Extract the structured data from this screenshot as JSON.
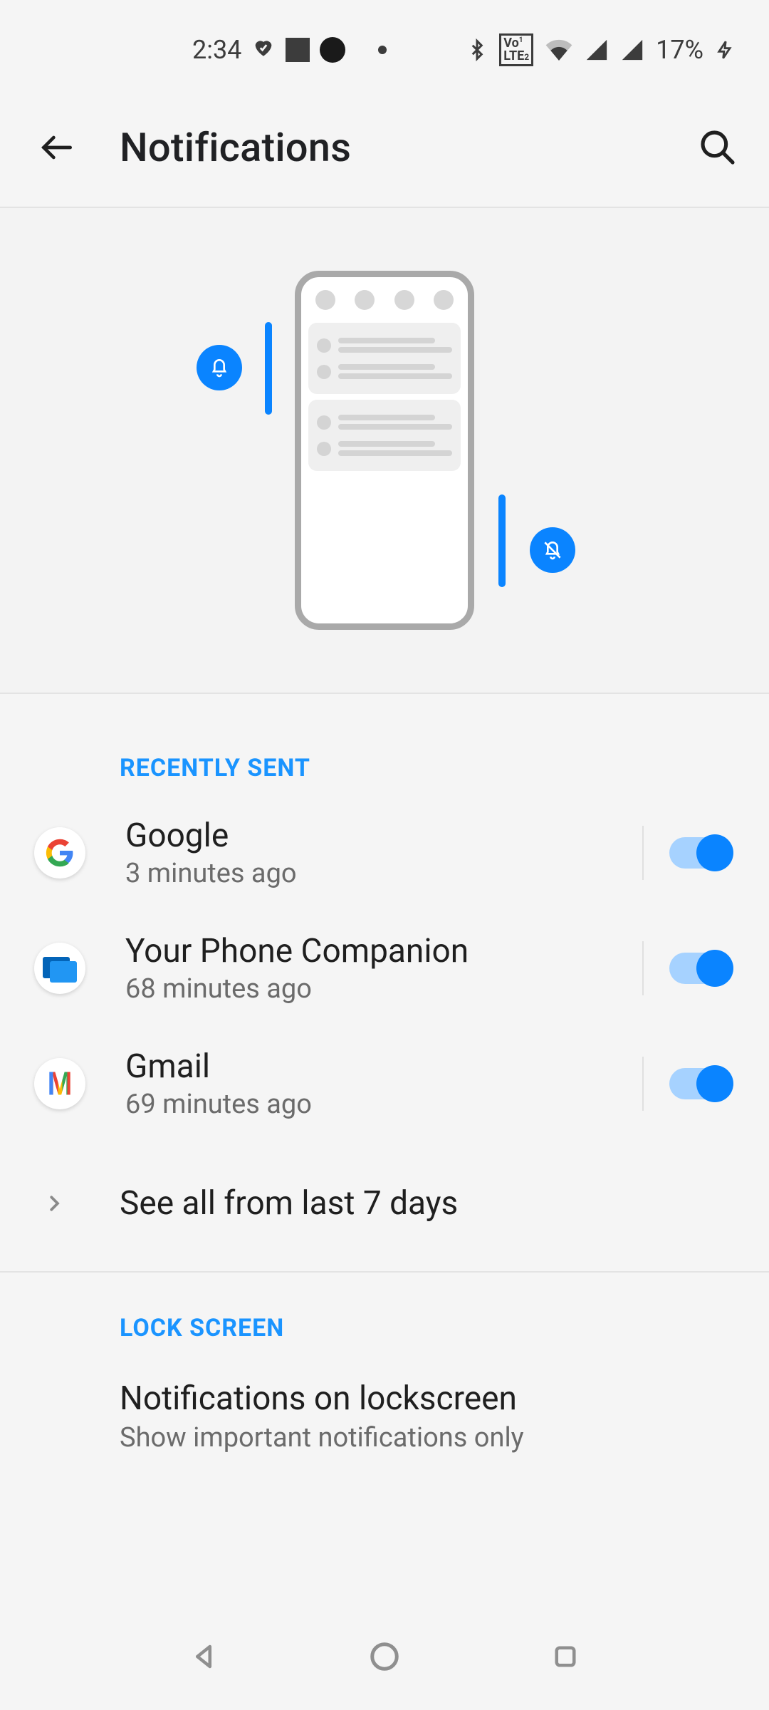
{
  "status": {
    "time": "2:34",
    "battery": "17%"
  },
  "header": {
    "title": "Notifications"
  },
  "section1_label": "RECENTLY SENT",
  "items": [
    {
      "title": "Google",
      "sub": "3 minutes ago"
    },
    {
      "title": "Your Phone Companion",
      "sub": "68 minutes ago"
    },
    {
      "title": "Gmail",
      "sub": "69 minutes ago"
    }
  ],
  "see_all": "See all from last 7 days",
  "section2_label": "LOCK SCREEN",
  "lock": {
    "title": "Notifications on lockscreen",
    "sub": "Show important notifications only"
  }
}
